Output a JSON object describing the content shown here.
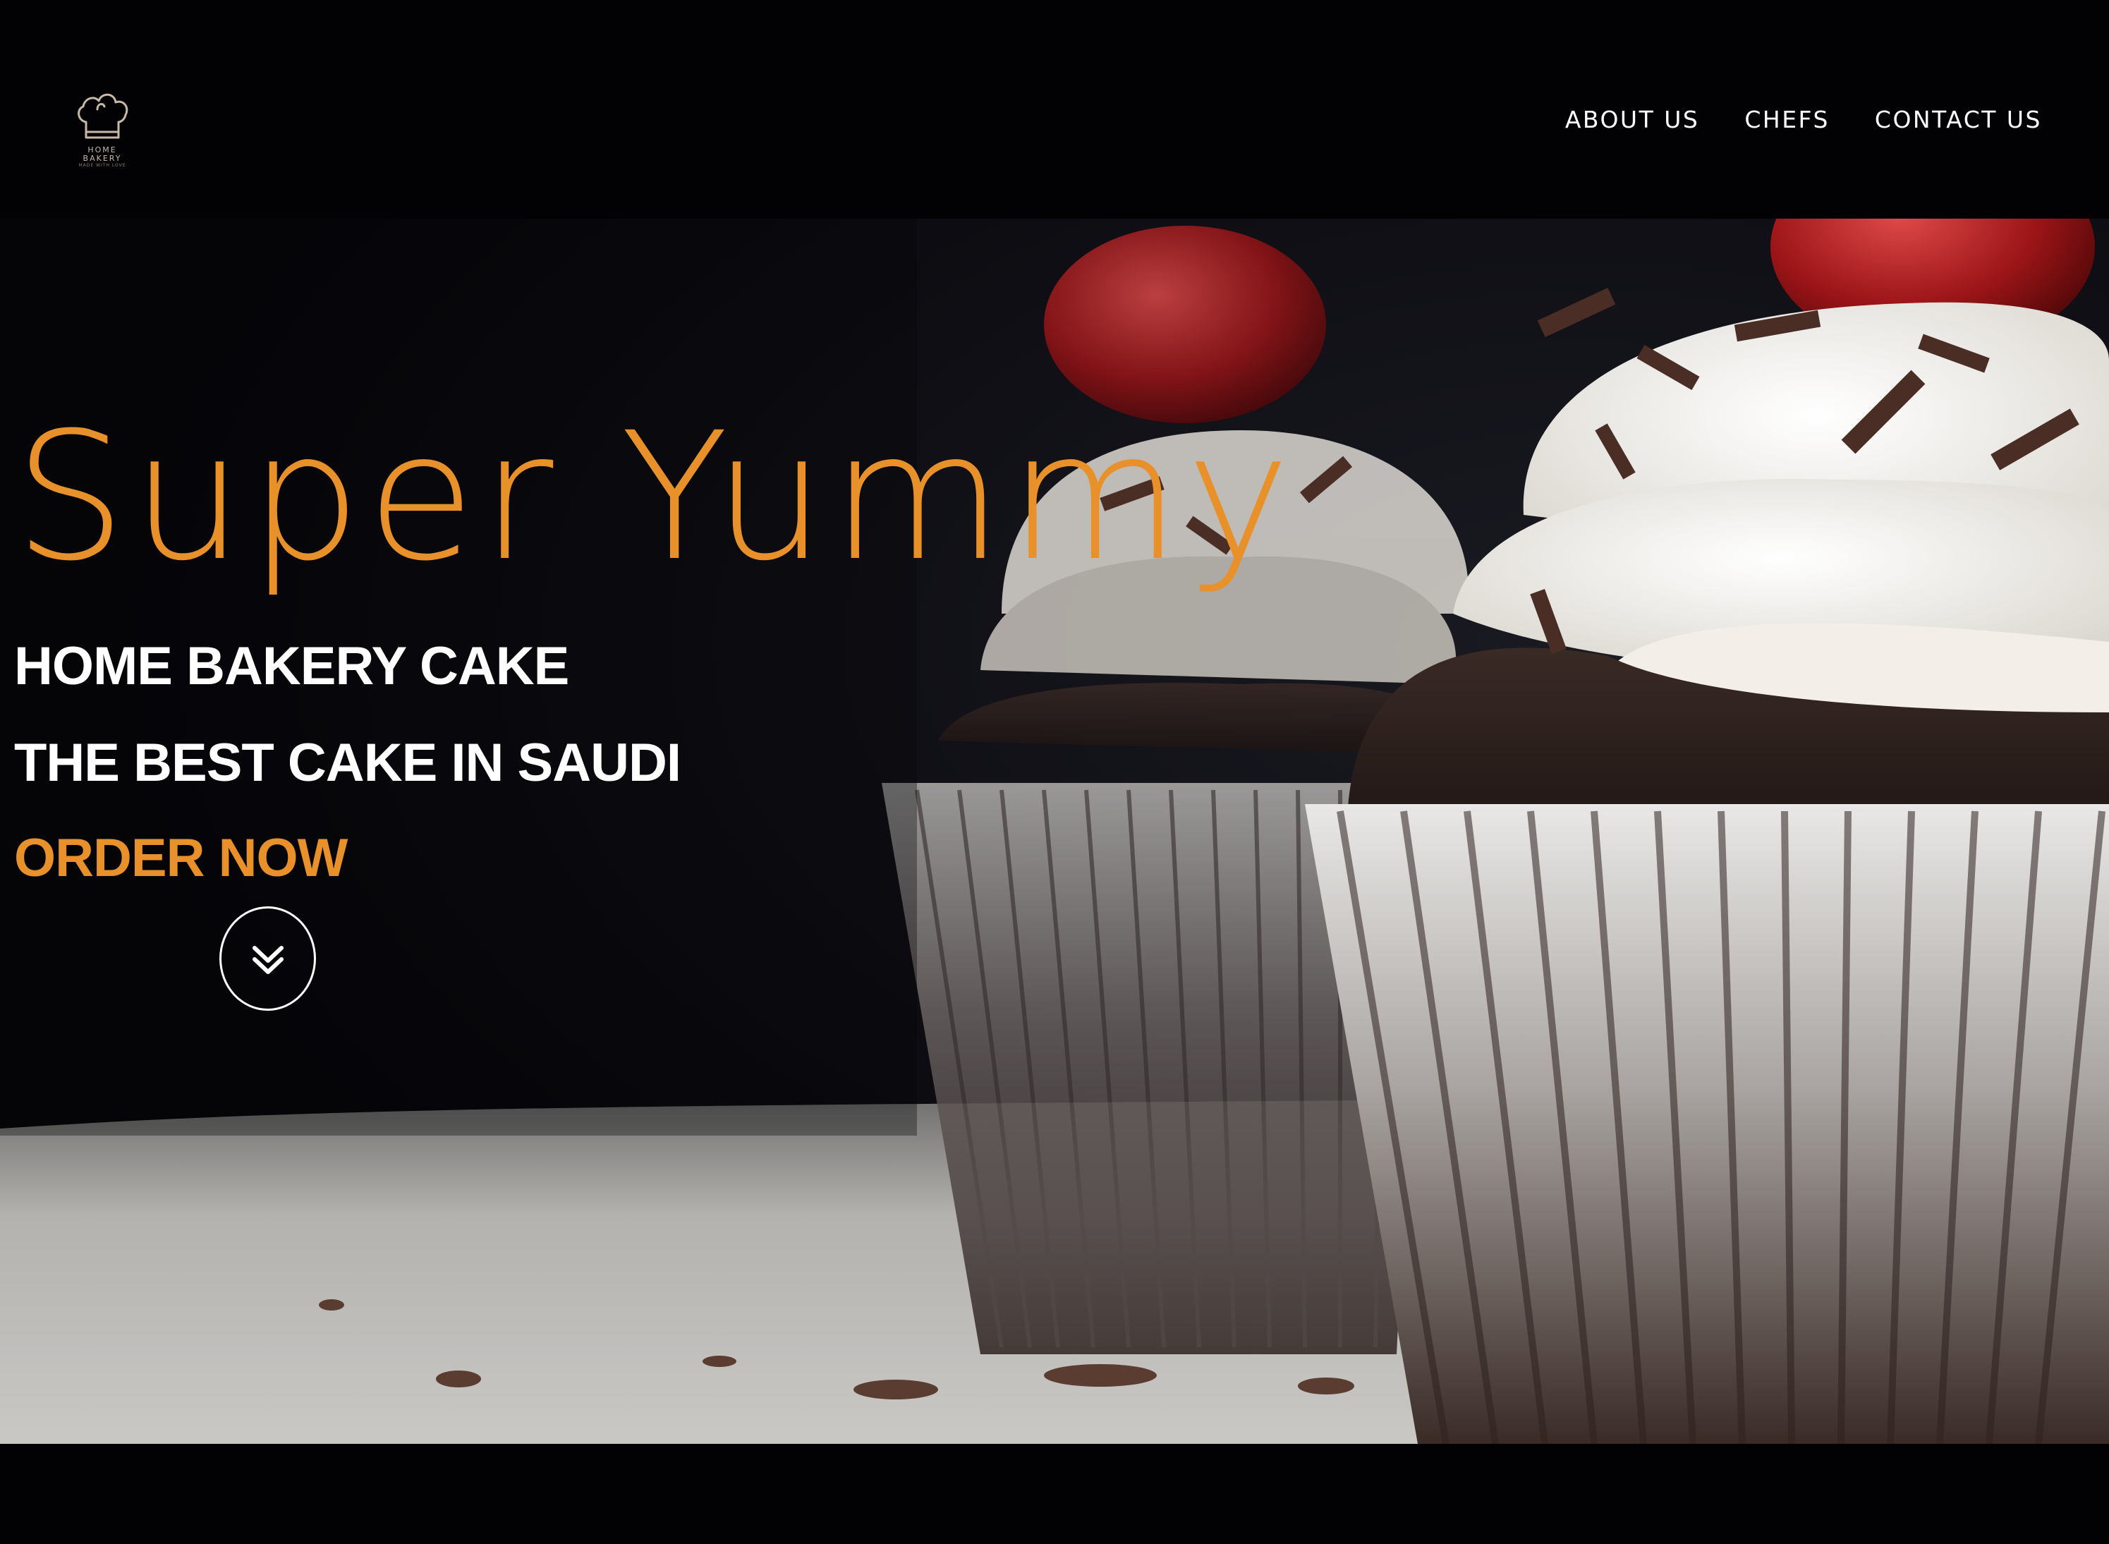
{
  "brand": {
    "name_line1": "HOME",
    "name_line2": "BAKERY",
    "tagline": "MADE WITH LOVE",
    "logo_icon": "chef-hat-icon"
  },
  "nav": {
    "items": [
      {
        "label": "ABOUT US"
      },
      {
        "label": "CHEFS"
      },
      {
        "label": "CONTACT US"
      }
    ]
  },
  "hero": {
    "headline": "Super Yummy",
    "subline_1": "HOME BAKERY CAKE",
    "subline_2": "THE BEST CAKE IN SAUDI",
    "cta_label": "ORDER NOW",
    "scroll_icon": "double-chevron-down-icon",
    "background_image": "chocolate-cupcakes-with-cream-and-cherry"
  },
  "colors": {
    "accent": "#e8912a",
    "header_bg": "#020204",
    "text": "#ffffff"
  }
}
